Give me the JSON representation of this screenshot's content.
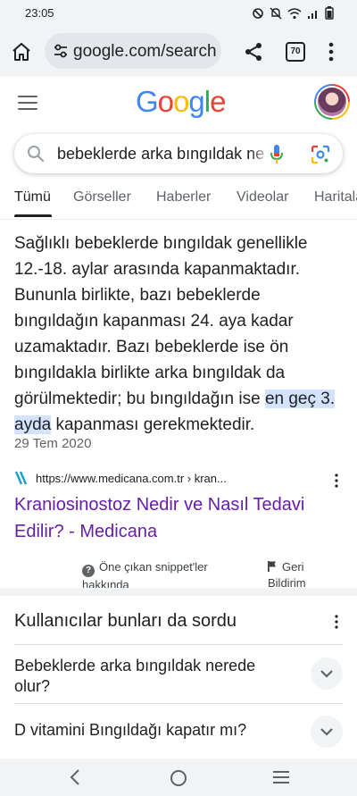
{
  "status_bar": {
    "time": "23:05"
  },
  "browser": {
    "url": "google.com/search",
    "tab_count": "70"
  },
  "google": {
    "logo_letters": [
      {
        "char": "G",
        "color": "#4285f4"
      },
      {
        "char": "o",
        "color": "#ea4335"
      },
      {
        "char": "o",
        "color": "#fbbc05"
      },
      {
        "char": "g",
        "color": "#4285f4"
      },
      {
        "char": "l",
        "color": "#34a853"
      },
      {
        "char": "e",
        "color": "#ea4335"
      }
    ]
  },
  "search": {
    "query": "bebeklerde arka bıngıldak ne zaman kapanır"
  },
  "tabs": [
    "Tümü",
    "Görseller",
    "Haberler",
    "Videolar",
    "Haritalar"
  ],
  "snippet": {
    "text_before": "Sağlıklı bebeklerde bıngıldak genellikle 12.-18. aylar arasında kapanmaktadır. Bununla birlikte, bazı bebeklerde bıngıldağın kapanması 24. aya kadar uzamaktadır. Bazı bebeklerde ise ön bıngıldakla birlikte arka bıngıldak da görülmektedir; bu bıngıldağın ise ",
    "highlight": "en geç 3. ayda",
    "text_after": " kapanması gerekmektedir.",
    "date": "29 Tem 2020"
  },
  "result": {
    "url": "https://www.medicana.com.tr › kran...",
    "title": "Kraniosinostoz Nedir ve Nasıl Tedavi Edilir? - Medicana"
  },
  "about": {
    "snippets_label": "Öne çıkan snippet'ler hakkında",
    "feedback_label": "Geri Bildirim"
  },
  "paa": {
    "title": "Kullanıcılar bunları da sordu",
    "questions": [
      "Bebeklerde arka bıngıldak nerede olur?",
      "D vitamini Bıngıldağı kapatır mı?"
    ]
  },
  "colors": {
    "visited_link": "#681da8",
    "highlight": "#d3e3fd",
    "chrome_bg": "#f1f3f4"
  }
}
